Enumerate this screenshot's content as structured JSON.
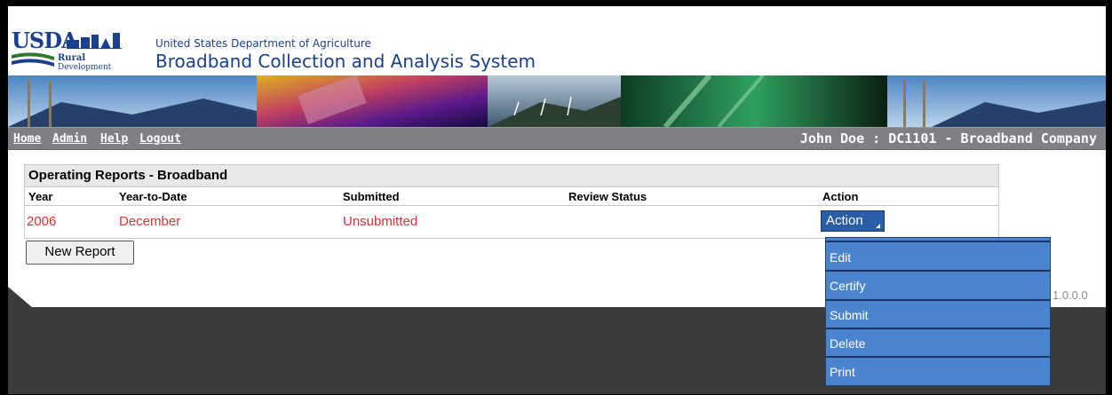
{
  "header": {
    "logo_usda": "USDA",
    "logo_rural": "Rural",
    "logo_development": "Development",
    "agency": "United States Department of Agriculture",
    "system_name": "Broadband Collection and Analysis System"
  },
  "nav": {
    "links": [
      "Home",
      "Admin",
      "Help",
      "Logout"
    ],
    "user_info": "John Doe : DC1101 - Broadband Company"
  },
  "report": {
    "title": "Operating Reports - Broadband",
    "columns": [
      "Year",
      "Year-to-Date",
      "Submitted",
      "Review Status",
      "Action"
    ],
    "row": {
      "year": "2006",
      "year_to_date": "December",
      "submitted": "Unsubmitted",
      "review_status": ""
    },
    "action_label": "Action",
    "new_report_label": "New Report"
  },
  "action_menu": {
    "items": [
      "Edit",
      "Certify",
      "Submit",
      "Delete",
      "Print"
    ]
  },
  "version": "1.0.0.0",
  "colors": {
    "nav_bg": "#7f7f86",
    "row_text": "#e03030",
    "menu_bg": "#4a84cf",
    "brand_blue": "#1b3f8f"
  }
}
